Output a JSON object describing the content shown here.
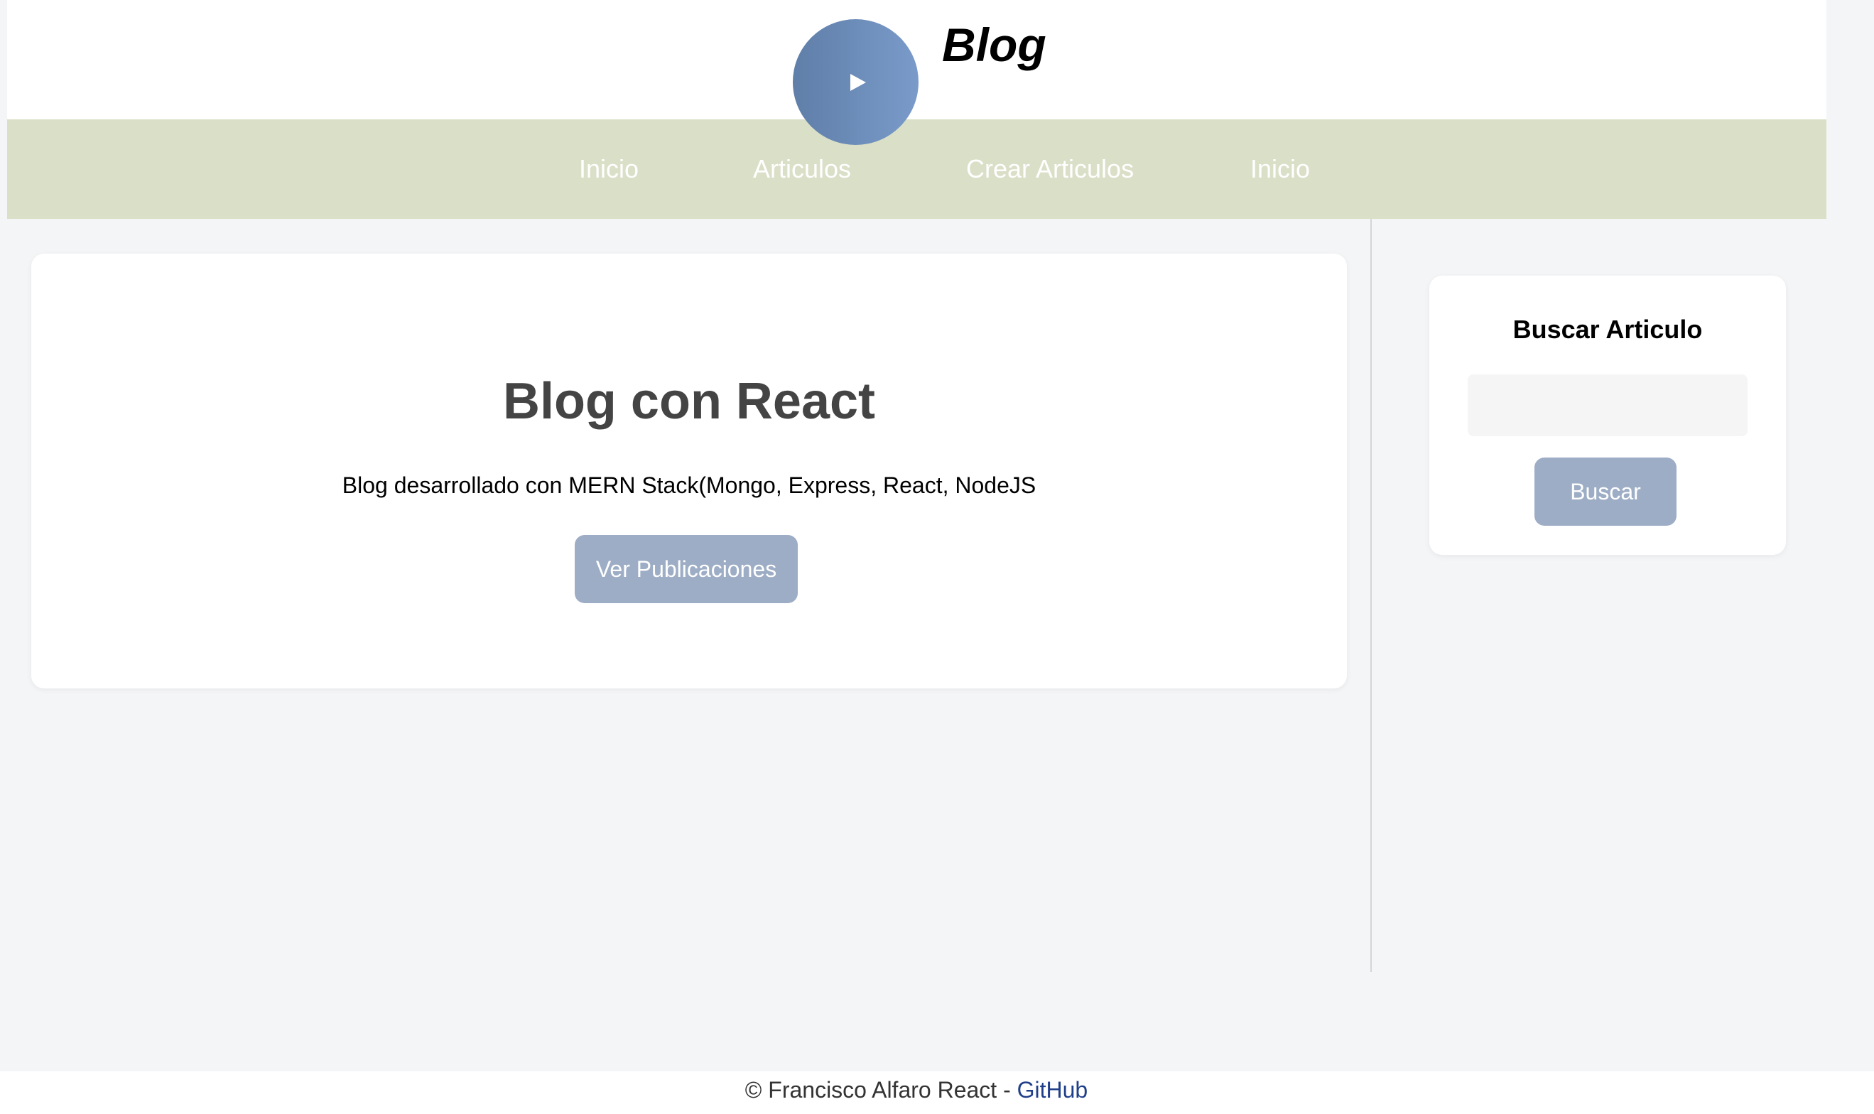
{
  "header": {
    "logo_icon": "play-icon",
    "brand_title": "Blog",
    "colors": {
      "logo_gradient_start": "#5f7ea8",
      "logo_gradient_end": "#7a9bca"
    }
  },
  "nav": {
    "background": "#dadfc7",
    "items": [
      {
        "label": "Inicio"
      },
      {
        "label": "Articulos"
      },
      {
        "label": "Crear Articulos"
      },
      {
        "label": "Inicio"
      }
    ]
  },
  "hero": {
    "title": "Blog con React",
    "description": "Blog desarrollado con MERN Stack(Mongo, Express, React, NodeJS",
    "button_label": "Ver Publicaciones"
  },
  "sidebar": {
    "search_title": "Buscar Articulo",
    "search_value": "",
    "search_button_label": "Buscar"
  },
  "footer": {
    "text": "© Francisco Alfaro React - ",
    "link_label": "GitHub"
  },
  "colors": {
    "button_bg": "#9dadc5",
    "page_bg": "#f4f5f7",
    "link": "#1f3f8a"
  }
}
